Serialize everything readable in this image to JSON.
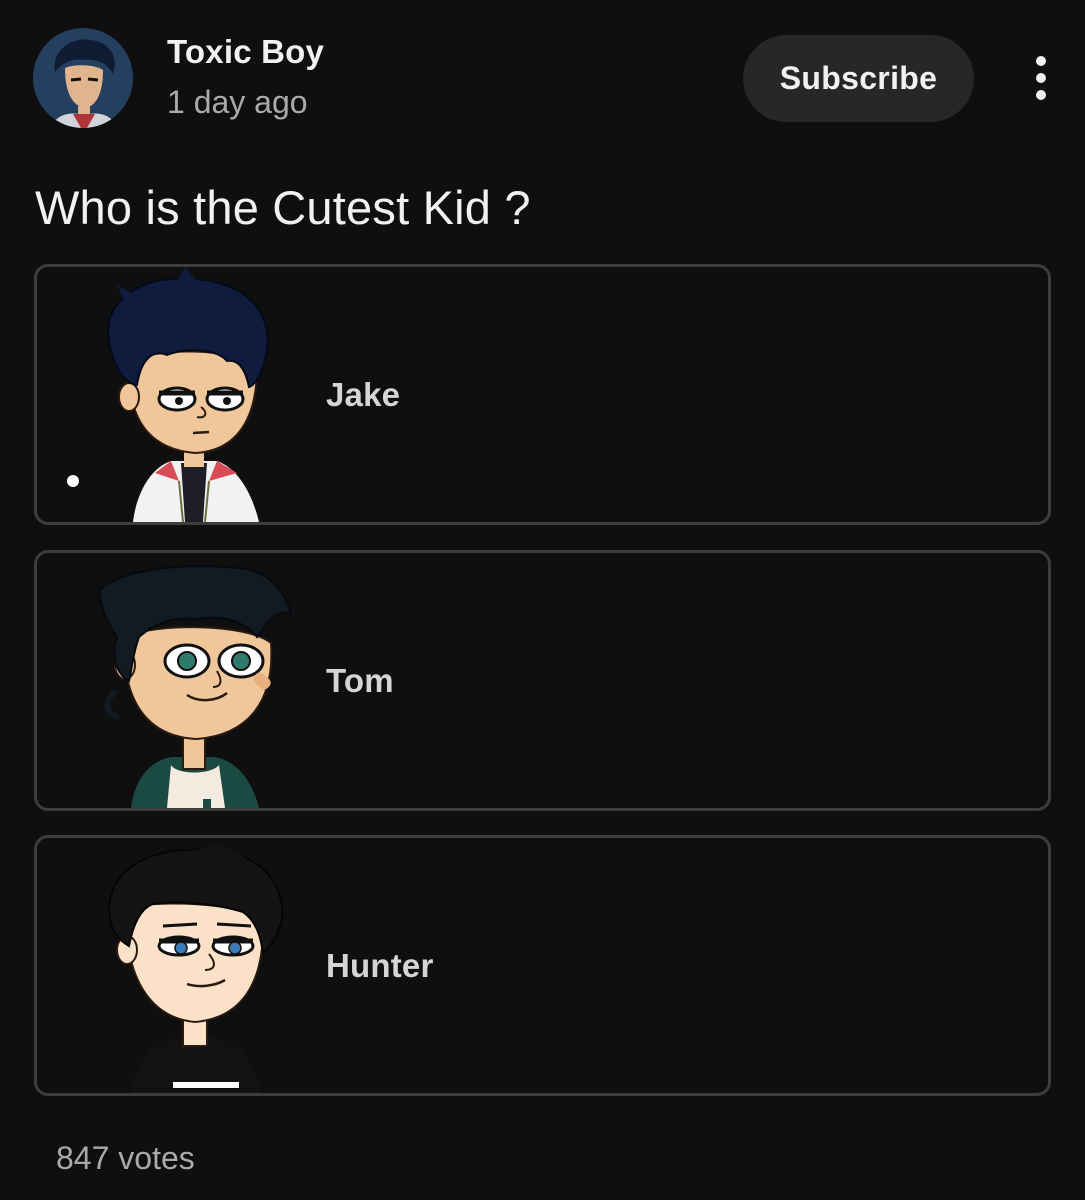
{
  "channel": {
    "name": "Toxic Boy",
    "time": "1 day ago",
    "avatar_icon": "cartoon-avatar"
  },
  "actions": {
    "subscribe_label": "Subscribe",
    "more_icon": "more-vertical-icon"
  },
  "poll": {
    "question": "Who is the Cutest Kid ?",
    "options": [
      {
        "label": "Jake",
        "image": "cartoon-boy-jake"
      },
      {
        "label": "Tom",
        "image": "cartoon-boy-tom"
      },
      {
        "label": "Hunter",
        "image": "cartoon-boy-hunter"
      }
    ],
    "votes": "847 votes"
  },
  "colors": {
    "background": "#0f0f0f",
    "button_bg": "#272727",
    "border": "#3d3d3d",
    "text_primary": "#f1f1f1",
    "text_secondary": "#aaaaaa"
  }
}
